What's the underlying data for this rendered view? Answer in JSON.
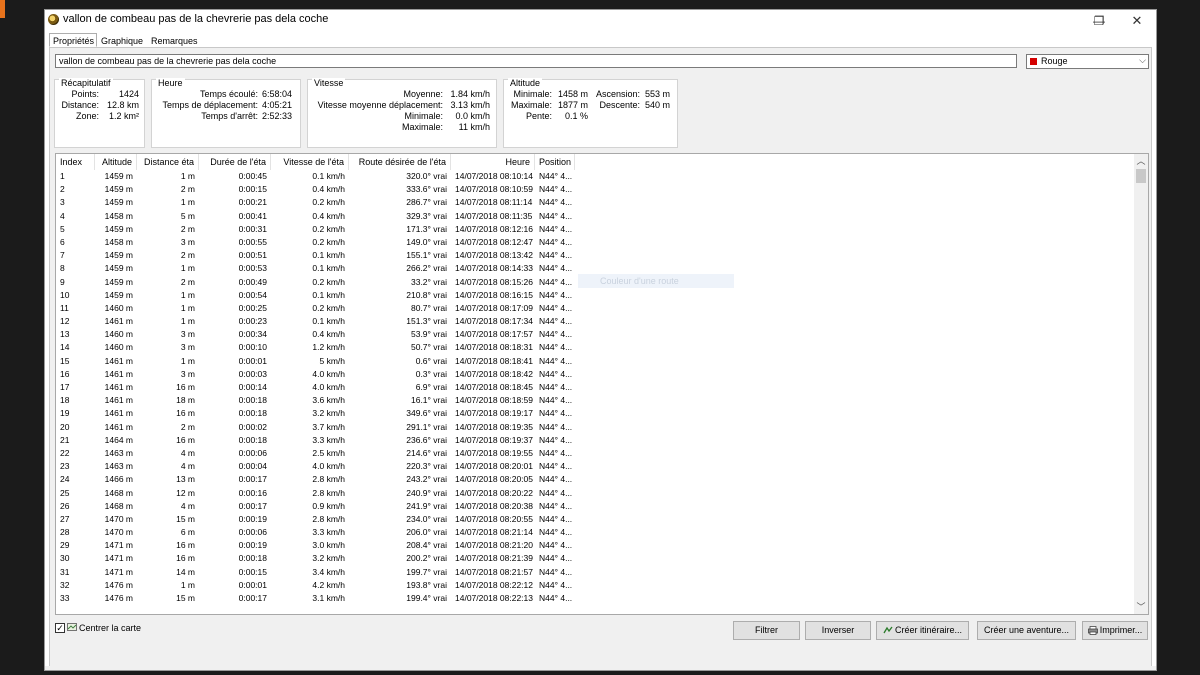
{
  "window": {
    "title": "vallon de combeau pas de la chevrerie pas dela coche",
    "controls": {
      "minimize": "—",
      "restore": "❐",
      "close": "✕"
    }
  },
  "tabs": [
    {
      "label": "Propriétés",
      "active": true
    },
    {
      "label": "Graphique",
      "active": false
    },
    {
      "label": "Remarques",
      "active": false
    }
  ],
  "track_name": "vallon de combeau pas de la chevrerie pas dela coche",
  "color": {
    "label": "Rouge",
    "value": "#d40000"
  },
  "summary": {
    "title": "Récapitulatif",
    "rows": [
      {
        "label": "Points:",
        "value": "1424"
      },
      {
        "label": "Distance:",
        "value": "12.8 km"
      },
      {
        "label": "Zone:",
        "value": "1.2 km²"
      }
    ]
  },
  "time": {
    "title": "Heure",
    "rows": [
      {
        "label": "Temps écoulé:",
        "value": "6:58:04"
      },
      {
        "label": "Temps de déplacement:",
        "value": "4:05:21"
      },
      {
        "label": "Temps d'arrêt:",
        "value": "2:52:33"
      }
    ]
  },
  "speed": {
    "title": "Vitesse",
    "rows": [
      {
        "label": "Moyenne:",
        "value": "1.84 km/h"
      },
      {
        "label": "Vitesse moyenne déplacement:",
        "value": "3.13 km/h"
      },
      {
        "label": "Minimale:",
        "value": "0.0 km/h"
      },
      {
        "label": "Maximale:",
        "value": "11 km/h"
      }
    ]
  },
  "altitude": {
    "title": "Altitude",
    "left": [
      {
        "label": "Minimale:",
        "value": "1458 m"
      },
      {
        "label": "Maximale:",
        "value": "1877 m"
      },
      {
        "label": "Pente:",
        "value": "0.1 %"
      }
    ],
    "right": [
      {
        "label": "Ascension:",
        "value": "553 m"
      },
      {
        "label": "Descente:",
        "value": "540 m"
      }
    ]
  },
  "table": {
    "columns": [
      "Index",
      "Altitude",
      "Distance éta",
      "Durée de l'éta",
      "Vitesse de l'éta",
      "Route désirée de l'éta",
      "Heure",
      "Position"
    ],
    "rows": [
      [
        "1",
        "1459 m",
        "1 m",
        "0:00:45",
        "0.1 km/h",
        "320.0° vrai",
        "14/07/2018 08:10:14",
        "N44° 4..."
      ],
      [
        "2",
        "1459 m",
        "2 m",
        "0:00:15",
        "0.4 km/h",
        "333.6° vrai",
        "14/07/2018 08:10:59",
        "N44° 4..."
      ],
      [
        "3",
        "1459 m",
        "1 m",
        "0:00:21",
        "0.2 km/h",
        "286.7° vrai",
        "14/07/2018 08:11:14",
        "N44° 4..."
      ],
      [
        "4",
        "1458 m",
        "5 m",
        "0:00:41",
        "0.4 km/h",
        "329.3° vrai",
        "14/07/2018 08:11:35",
        "N44° 4..."
      ],
      [
        "5",
        "1459 m",
        "2 m",
        "0:00:31",
        "0.2 km/h",
        "171.3° vrai",
        "14/07/2018 08:12:16",
        "N44° 4..."
      ],
      [
        "6",
        "1458 m",
        "3 m",
        "0:00:55",
        "0.2 km/h",
        "149.0° vrai",
        "14/07/2018 08:12:47",
        "N44° 4..."
      ],
      [
        "7",
        "1459 m",
        "2 m",
        "0:00:51",
        "0.1 km/h",
        "155.1° vrai",
        "14/07/2018 08:13:42",
        "N44° 4..."
      ],
      [
        "8",
        "1459 m",
        "1 m",
        "0:00:53",
        "0.1 km/h",
        "266.2° vrai",
        "14/07/2018 08:14:33",
        "N44° 4..."
      ],
      [
        "9",
        "1459 m",
        "2 m",
        "0:00:49",
        "0.2 km/h",
        "33.2° vrai",
        "14/07/2018 08:15:26",
        "N44° 4..."
      ],
      [
        "10",
        "1459 m",
        "1 m",
        "0:00:54",
        "0.1 km/h",
        "210.8° vrai",
        "14/07/2018 08:16:15",
        "N44° 4..."
      ],
      [
        "11",
        "1460 m",
        "1 m",
        "0:00:25",
        "0.2 km/h",
        "80.7° vrai",
        "14/07/2018 08:17:09",
        "N44° 4..."
      ],
      [
        "12",
        "1461 m",
        "1 m",
        "0:00:23",
        "0.1 km/h",
        "151.3° vrai",
        "14/07/2018 08:17:34",
        "N44° 4..."
      ],
      [
        "13",
        "1460 m",
        "3 m",
        "0:00:34",
        "0.4 km/h",
        "53.9° vrai",
        "14/07/2018 08:17:57",
        "N44° 4..."
      ],
      [
        "14",
        "1460 m",
        "3 m",
        "0:00:10",
        "1.2 km/h",
        "50.7° vrai",
        "14/07/2018 08:18:31",
        "N44° 4..."
      ],
      [
        "15",
        "1461 m",
        "1 m",
        "0:00:01",
        "5 km/h",
        "0.6° vrai",
        "14/07/2018 08:18:41",
        "N44° 4..."
      ],
      [
        "16",
        "1461 m",
        "3 m",
        "0:00:03",
        "4.0 km/h",
        "0.3° vrai",
        "14/07/2018 08:18:42",
        "N44° 4..."
      ],
      [
        "17",
        "1461 m",
        "16 m",
        "0:00:14",
        "4.0 km/h",
        "6.9° vrai",
        "14/07/2018 08:18:45",
        "N44° 4..."
      ],
      [
        "18",
        "1461 m",
        "18 m",
        "0:00:18",
        "3.6 km/h",
        "16.1° vrai",
        "14/07/2018 08:18:59",
        "N44° 4..."
      ],
      [
        "19",
        "1461 m",
        "16 m",
        "0:00:18",
        "3.2 km/h",
        "349.6° vrai",
        "14/07/2018 08:19:17",
        "N44° 4..."
      ],
      [
        "20",
        "1461 m",
        "2 m",
        "0:00:02",
        "3.7 km/h",
        "291.1° vrai",
        "14/07/2018 08:19:35",
        "N44° 4..."
      ],
      [
        "21",
        "1464 m",
        "16 m",
        "0:00:18",
        "3.3 km/h",
        "236.6° vrai",
        "14/07/2018 08:19:37",
        "N44° 4..."
      ],
      [
        "22",
        "1463 m",
        "4 m",
        "0:00:06",
        "2.5 km/h",
        "214.6° vrai",
        "14/07/2018 08:19:55",
        "N44° 4..."
      ],
      [
        "23",
        "1463 m",
        "4 m",
        "0:00:04",
        "4.0 km/h",
        "220.3° vrai",
        "14/07/2018 08:20:01",
        "N44° 4..."
      ],
      [
        "24",
        "1466 m",
        "13 m",
        "0:00:17",
        "2.8 km/h",
        "243.2° vrai",
        "14/07/2018 08:20:05",
        "N44° 4..."
      ],
      [
        "25",
        "1468 m",
        "12 m",
        "0:00:16",
        "2.8 km/h",
        "240.9° vrai",
        "14/07/2018 08:20:22",
        "N44° 4..."
      ],
      [
        "26",
        "1468 m",
        "4 m",
        "0:00:17",
        "0.9 km/h",
        "241.9° vrai",
        "14/07/2018 08:20:38",
        "N44° 4..."
      ],
      [
        "27",
        "1470 m",
        "15 m",
        "0:00:19",
        "2.8 km/h",
        "234.0° vrai",
        "14/07/2018 08:20:55",
        "N44° 4..."
      ],
      [
        "28",
        "1470 m",
        "6 m",
        "0:00:06",
        "3.3 km/h",
        "206.0° vrai",
        "14/07/2018 08:21:14",
        "N44° 4..."
      ],
      [
        "29",
        "1471 m",
        "16 m",
        "0:00:19",
        "3.0 km/h",
        "208.4° vrai",
        "14/07/2018 08:21:20",
        "N44° 4..."
      ],
      [
        "30",
        "1471 m",
        "16 m",
        "0:00:18",
        "3.2 km/h",
        "200.2° vrai",
        "14/07/2018 08:21:39",
        "N44° 4..."
      ],
      [
        "31",
        "1471 m",
        "14 m",
        "0:00:15",
        "3.4 km/h",
        "199.7° vrai",
        "14/07/2018 08:21:57",
        "N44° 4..."
      ],
      [
        "32",
        "1476 m",
        "1 m",
        "0:00:01",
        "4.2 km/h",
        "193.8° vrai",
        "14/07/2018 08:22:12",
        "N44° 4..."
      ],
      [
        "33",
        "1476 m",
        "15 m",
        "0:00:17",
        "3.1 km/h",
        "199.4° vrai",
        "14/07/2018 08:22:13",
        "N44° 4..."
      ]
    ]
  },
  "ghost_tooltip": "Couleur d'une route",
  "bottom": {
    "center_map_label": "Centrer la carte",
    "center_map_checked": true,
    "buttons": {
      "filter": "Filtrer",
      "invert": "Inverser",
      "create_route": "Créer itinéraire...",
      "create_adventure": "Créer une aventure...",
      "print": "Imprimer..."
    }
  }
}
